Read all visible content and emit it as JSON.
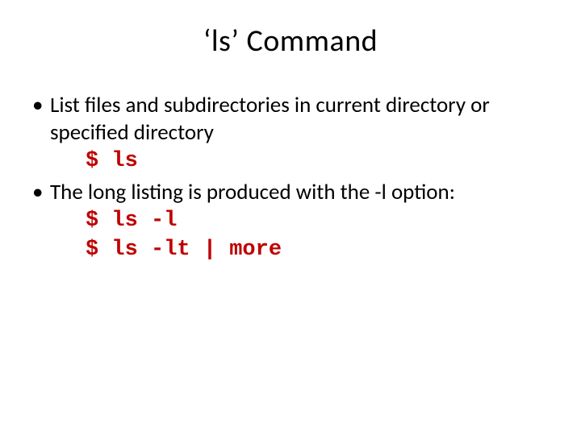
{
  "title": "‘ls’ Command",
  "bullets": [
    {
      "text": "List files and subdirectories in current directory or specified directory",
      "code": [
        "$ ls"
      ]
    },
    {
      "text": "The long listing is produced with the -l option:",
      "code": [
        "$ ls -l",
        "$ ls -lt | more"
      ]
    }
  ]
}
